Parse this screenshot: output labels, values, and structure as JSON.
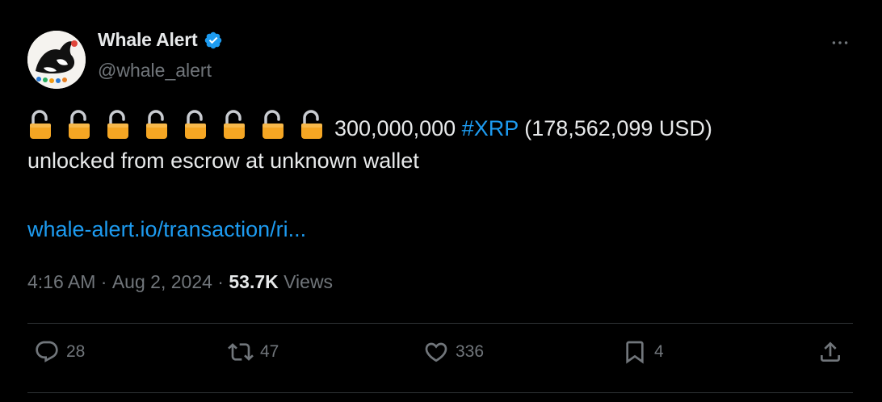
{
  "author": {
    "display_name": "Whale Alert",
    "handle": "@whale_alert",
    "verified": true
  },
  "tweet": {
    "lock_icons": [
      "open-lock-icon",
      "open-lock-icon",
      "open-lock-icon",
      "open-lock-icon",
      "open-lock-icon",
      "open-lock-icon",
      "open-lock-icon",
      "open-lock-icon"
    ],
    "amount": "300,000,000",
    "hashtag": "#XRP",
    "usd": "(178,562,099 USD)",
    "line2": "unlocked from escrow at unknown wallet",
    "link": "whale-alert.io/transaction/ri..."
  },
  "meta": {
    "time": "4:16 AM",
    "separator": "·",
    "date": "Aug 2, 2024",
    "views_count": "53.7K",
    "views_label": "Views"
  },
  "actions": {
    "replies": "28",
    "reposts": "47",
    "likes": "336",
    "bookmarks": "4"
  },
  "colors": {
    "background": "#000000",
    "text": "#e7e9ea",
    "muted": "#71767b",
    "link": "#1d9bf0",
    "lock": "#f5a623",
    "divider": "#2f3336"
  }
}
